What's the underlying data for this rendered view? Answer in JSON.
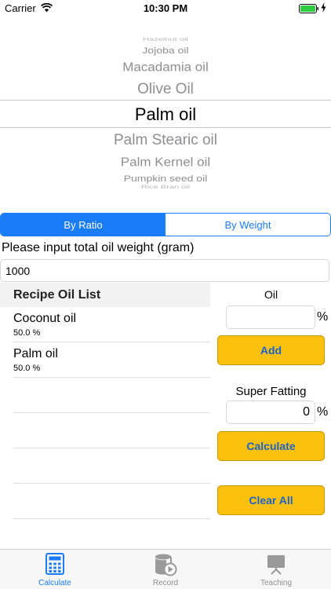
{
  "status_bar": {
    "carrier": "Carrier",
    "time": "10:30 PM"
  },
  "picker": {
    "items": [
      "Hazelnut oil",
      "Jojoba oil",
      "Macadamia oil",
      "Olive Oil",
      "Palm oil",
      "Palm Stearic oil",
      "Palm Kernel oil",
      "Pumpkin seed oil",
      "Rice Bran oil"
    ],
    "selected": "Palm oil"
  },
  "segmented": {
    "options": [
      "By Ratio",
      "By Weight"
    ],
    "selected": "By Ratio"
  },
  "total_weight": {
    "label": "Please input total oil weight (gram)",
    "value": "1000"
  },
  "recipe_list": {
    "header": "Recipe Oil List",
    "items": [
      {
        "name": "Coconut oil",
        "percent": "50.0 %"
      },
      {
        "name": "Palm oil",
        "percent": "50.0 %"
      }
    ]
  },
  "oil_form": {
    "label": "Oil",
    "value": "",
    "unit": "%",
    "add_label": "Add"
  },
  "super_fatting": {
    "label": "Super Fatting",
    "value": "0",
    "unit": "%",
    "calculate_label": "Calculate",
    "clear_label": "Clear All"
  },
  "tabs": [
    {
      "label": "Calculate",
      "icon": "calculator-icon",
      "active": true
    },
    {
      "label": "Record",
      "icon": "record-icon",
      "active": false
    },
    {
      "label": "Teaching",
      "icon": "teaching-icon",
      "active": false
    }
  ],
  "colors": {
    "accent": "#1a7cf7",
    "button_yellow": "#fcc10f",
    "button_text": "#1c62c7"
  }
}
